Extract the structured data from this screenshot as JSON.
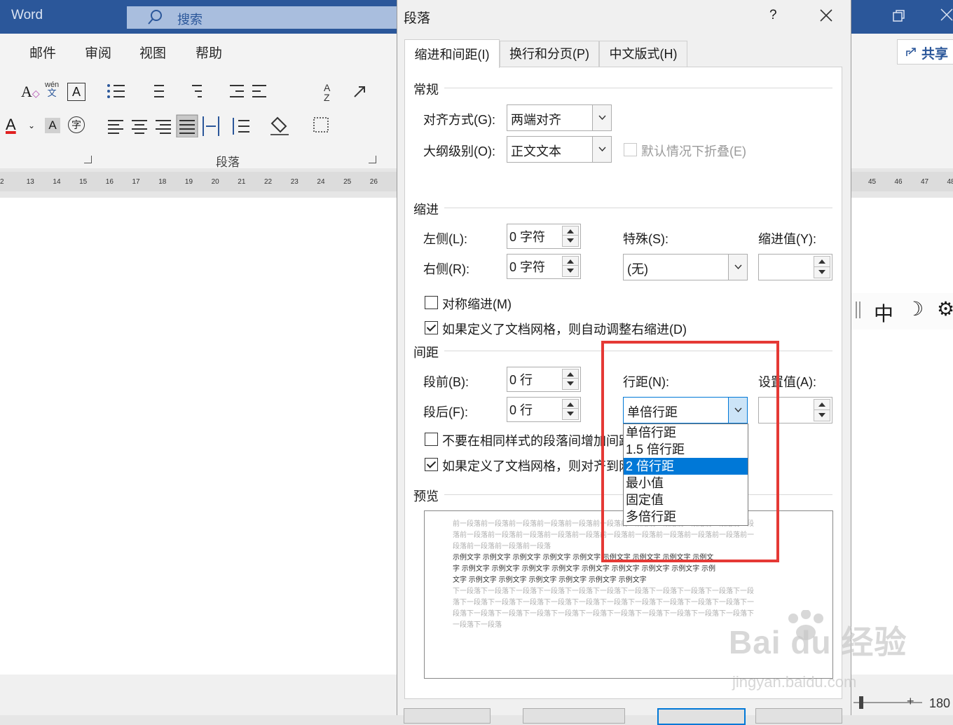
{
  "word": {
    "app_name": "Word",
    "search_placeholder": "搜索",
    "ribbon_tabs": [
      "邮件",
      "审阅",
      "视图",
      "帮助"
    ],
    "share_label": "共享",
    "paragraph_group_label": "段落",
    "ruler_left": [
      "2",
      "13",
      "14",
      "15",
      "16",
      "17",
      "18",
      "19",
      "20",
      "21",
      "22",
      "23",
      "24",
      "25",
      "26",
      "2"
    ],
    "ruler_right": [
      "45",
      "46",
      "47",
      "48"
    ],
    "zoom_text": "180",
    "ime_chinese": "中",
    "phonetic_label": "wén",
    "phonetic_sub": "文"
  },
  "dialog": {
    "title": "段落",
    "help_label": "?",
    "tabs": [
      "缩进和间距(I)",
      "换行和分页(P)",
      "中文版式(H)"
    ],
    "general": {
      "heading": "常规",
      "alignment_label": "对齐方式(G):",
      "alignment_value": "两端对齐",
      "outline_label": "大纲级别(O):",
      "outline_value": "正文文本",
      "collapse_label": "默认情况下折叠(E)"
    },
    "indent": {
      "heading": "缩进",
      "left_label": "左侧(L):",
      "left_value": "0 字符",
      "right_label": "右侧(R):",
      "right_value": "0 字符",
      "special_label": "特殊(S):",
      "special_value": "(无)",
      "by_label": "缩进值(Y):",
      "mirror_label": "对称缩进(M)",
      "auto_adjust_label": "如果定义了文档网格，则自动调整右缩进(D)"
    },
    "spacing": {
      "heading": "间距",
      "before_label": "段前(B):",
      "before_value": "0 行",
      "after_label": "段后(F):",
      "after_value": "0 行",
      "line_spacing_label": "行距(N):",
      "line_spacing_value": "单倍行距",
      "at_label": "设置值(A):",
      "no_space_label": "不要在相同样式的段落间增加间距",
      "snap_grid_label": "如果定义了文档网格，则对齐到网格",
      "options": [
        "单倍行距",
        "1.5 倍行距",
        "2 倍行距",
        "最小值",
        "固定值",
        "多倍行距"
      ],
      "highlighted_option": "2 倍行距"
    },
    "preview": {
      "heading": "预览",
      "prev_lines": [
        "前一段落前一段落前一段落前一段落前一段落前一段落前一段落前一段落前一段落前一段落前一段",
        "落前一段落前一段落前一段落前一段落前一段落前一段落前一段落前一段落前一段落前一段落前一",
        "段落前一段落前一段落前一段落"
      ],
      "sample_lines": [
        "示例文字 示例文字 示例文字 示例文字 示例文字 示例文字 示例文字 示例文字 示例文",
        "字 示例文字 示例文字 示例文字 示例文字 示例文字 示例文字 示例文字 示例文字 示例",
        "文字 示例文字 示例文字 示例文字 示例文字 示例文字 示例文字"
      ],
      "next_lines": [
        "下一段落下一段落下一段落下一段落下一段落下一段落下一段落下一段落下一段落下一段落下一段",
        "落下一段落下一段落下一段落下一段落下一段落下一段落下一段落下一段落下一段落下一段落下一",
        "段落下一段落下一段落下一段落下一段落下一段落下一段落下一段落下一段落下一段落下一段落下",
        "一段落下一段落"
      ]
    }
  },
  "watermark": {
    "brand": "Bai du 经验",
    "url": "jingyan.baidu.com"
  },
  "colors": {
    "title_bar": "#2b579a",
    "highlight": "#0078d7",
    "annotation_box": "#e53935"
  }
}
